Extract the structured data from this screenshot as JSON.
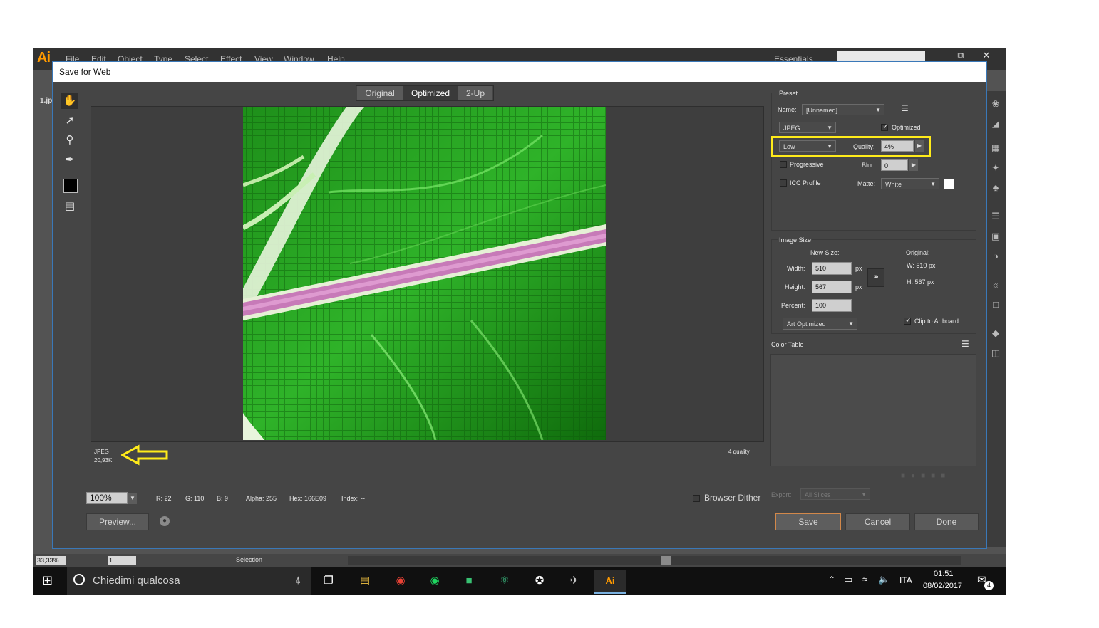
{
  "app": {
    "logo": "Ai",
    "menu": [
      "File",
      "Edit",
      "Object",
      "Type",
      "Select",
      "Effect",
      "View",
      "Window",
      "Help"
    ],
    "workspace": "Essentials",
    "doc_tab": "1.jp",
    "status": {
      "zoom": "33,33%",
      "page": "1",
      "tool": "Selection"
    }
  },
  "dialog": {
    "title": "Save for Web",
    "view_tabs": [
      "Original",
      "Optimized",
      "2-Up"
    ],
    "preview": {
      "format": "JPEG",
      "size": "20,93K",
      "quality_note": "4 quality"
    },
    "bottom_bar": {
      "zoom": "100%",
      "r": "R: 22",
      "g": "G: 110",
      "b": "B: 9",
      "alpha": "Alpha: 255",
      "hex": "Hex: 166E09",
      "index": "Index: --",
      "browser_dither": "Browser Dither",
      "preview_button": "Preview..."
    },
    "preset": {
      "section": "Preset",
      "name_label": "Name:",
      "name_value": "[Unnamed]",
      "format": "JPEG",
      "optimized_label": "Optimized",
      "optimized_checked": true,
      "compression": "Low",
      "quality_label": "Quality:",
      "quality_value": "4%",
      "progressive_label": "Progressive",
      "blur_label": "Blur:",
      "blur_value": "0",
      "icc_label": "ICC Profile",
      "matte_label": "Matte:",
      "matte_value": "White"
    },
    "image_size": {
      "section": "Image Size",
      "new_size_label": "New Size:",
      "width_label": "Width:",
      "width_value": "510",
      "height_label": "Height:",
      "height_value": "567",
      "percent_label": "Percent:",
      "percent_value": "100",
      "px": "px",
      "original_label": "Original:",
      "orig_w": "W:  510 px",
      "orig_h": "H:  567 px",
      "resample": "Art Optimized",
      "clip_label": "Clip to Artboard",
      "clip_checked": true
    },
    "color_table": {
      "section": "Color Table"
    },
    "export": {
      "label": "Export:",
      "value": "All Slices"
    },
    "buttons": {
      "save": "Save",
      "cancel": "Cancel",
      "done": "Done"
    }
  },
  "taskbar": {
    "search_placeholder": "Chiedimi qualcosa",
    "language": "ITA",
    "time": "01:51",
    "date": "08/02/2017",
    "notifications": "4",
    "active_app": "Ai"
  },
  "colors": {
    "highlight": "#ffeb1a",
    "save_border": "#d2884a",
    "ai_orange": "#ff9a00"
  }
}
